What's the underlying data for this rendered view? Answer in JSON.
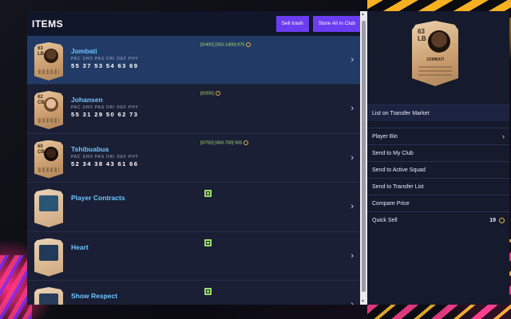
{
  "header": {
    "title": "ITEMS",
    "sell_trash_label": "Sell trash",
    "store_all_label": "Store All in Club"
  },
  "items": [
    {
      "name": "Jombati",
      "kind": "player",
      "ovr": "63",
      "pos": "LB",
      "attr_labels": "PAC SHO PAS DRI DEF PHY",
      "attr_values": "55 37 53 54 63 69",
      "meta": "[0/400] [350-1400] 875"
    },
    {
      "name": "Johansen",
      "kind": "player",
      "ovr": "62",
      "pos": "CB",
      "attr_labels": "PAC SHO PAS DRI DEF PHY",
      "attr_values": "55 31 29 50 62 73",
      "meta": "[0/200]"
    },
    {
      "name": "Tshibuabua",
      "kind": "player",
      "ovr": "60",
      "pos": "CB",
      "attr_labels": "PAC SHO PAS DRI DEF PHY",
      "attr_values": "52 34 38 43 61 66",
      "meta": "[0/750] [450-700] 565"
    },
    {
      "name": "Player Contracts",
      "kind": "item",
      "ovr": "",
      "pos": "",
      "attr_labels": "",
      "attr_values": "",
      "meta": ""
    },
    {
      "name": "Heart",
      "kind": "item",
      "ovr": "",
      "pos": "",
      "attr_labels": "",
      "attr_values": "",
      "meta": ""
    },
    {
      "name": "Show Respect",
      "kind": "item",
      "ovr": "",
      "pos": "",
      "attr_labels": "",
      "attr_values": "",
      "meta": ""
    }
  ],
  "detail": {
    "card_ovr": "63",
    "card_pos": "LB",
    "card_name": "JOMBATI",
    "actions": {
      "list_transfer": "List on Transfer Market",
      "player_bio": "Player Bio",
      "send_club": "Send to My Club",
      "send_squad": "Send to Active Squad",
      "send_transfer_list": "Send to Transfer List",
      "compare_price": "Compare Price",
      "quick_sell": "Quick Sell",
      "quick_sell_value": "19"
    }
  },
  "colors": {
    "accent": "#6b3df0",
    "name_blue": "#6fc6ff",
    "selected_row": "#213a66"
  }
}
